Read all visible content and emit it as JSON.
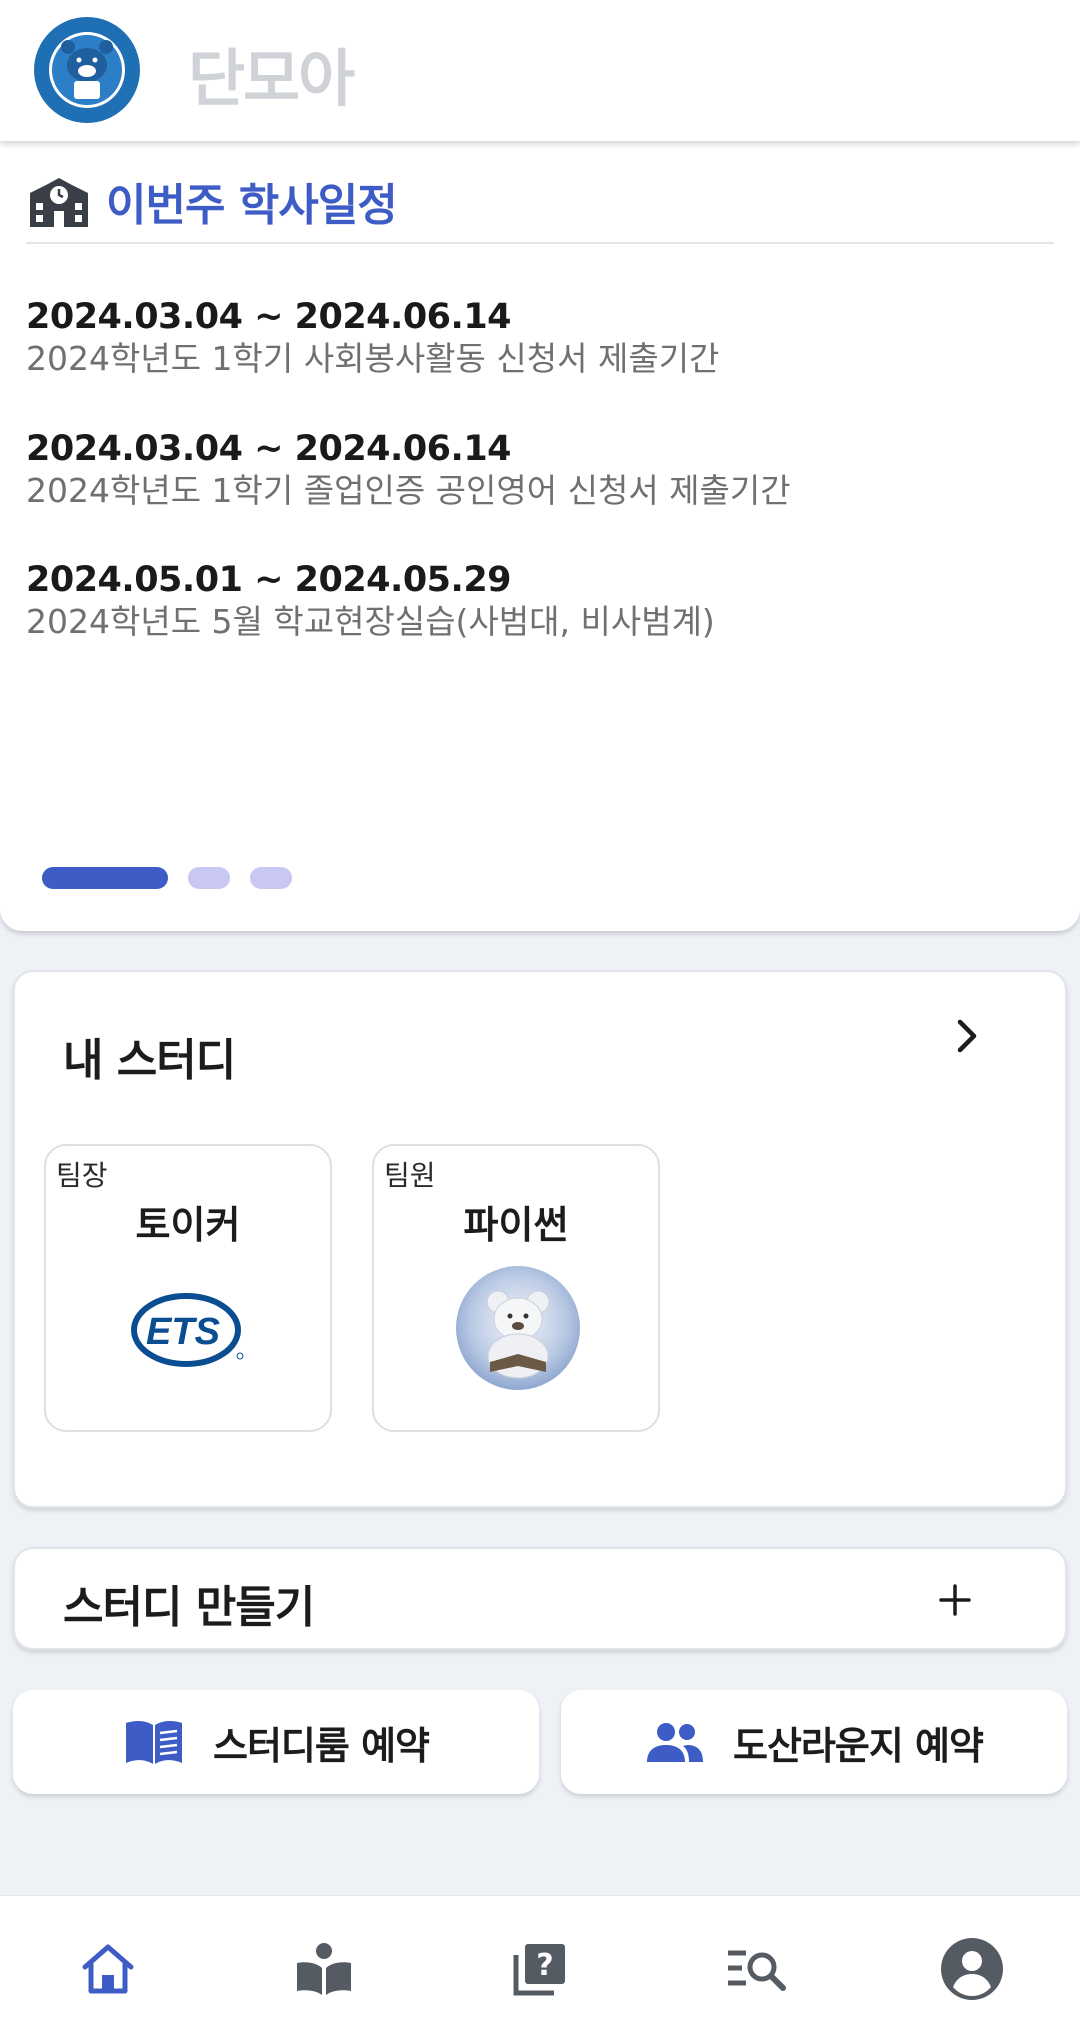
{
  "header": {
    "app_title": "단모아",
    "logo_icon": "university-bear-seal-icon"
  },
  "schedule": {
    "title": "이번주 학사일정",
    "icon": "school-icon",
    "events": [
      {
        "date": "2024.03.04 ~ 2024.06.14",
        "description": "2024학년도 1학기 사회봉사활동 신청서 제출기간"
      },
      {
        "date": "2024.03.04 ~ 2024.06.14",
        "description": "2024학년도 1학기 졸업인증 공인영어 신청서 제출기간"
      },
      {
        "date": "2024.05.01 ~ 2024.05.29",
        "description": "2024학년도 5월 학교현장실습(사범대, 비사범계)"
      }
    ],
    "pager": {
      "pages": 3,
      "active": 1
    }
  },
  "my_study": {
    "title": "내 스터디",
    "items": [
      {
        "role": "팀장",
        "name": "토이커",
        "thumbnail": "ets-logo"
      },
      {
        "role": "팀원",
        "name": "파이썬",
        "thumbnail": "teddy-bear-painting"
      }
    ]
  },
  "create_study": {
    "label": "스터디 만들기"
  },
  "reservations": {
    "study_room": "스터디룸 예약",
    "dosan_lounge": "도산라운지 예약"
  },
  "bottom_nav": {
    "items": [
      "home-icon",
      "book-icon",
      "question-icon",
      "search-list-icon",
      "profile-icon"
    ],
    "active": "home-icon"
  },
  "colors": {
    "accent": "#3e5cc5",
    "pager_inactive": "#c9c8f2",
    "background": "#eef1f6"
  }
}
